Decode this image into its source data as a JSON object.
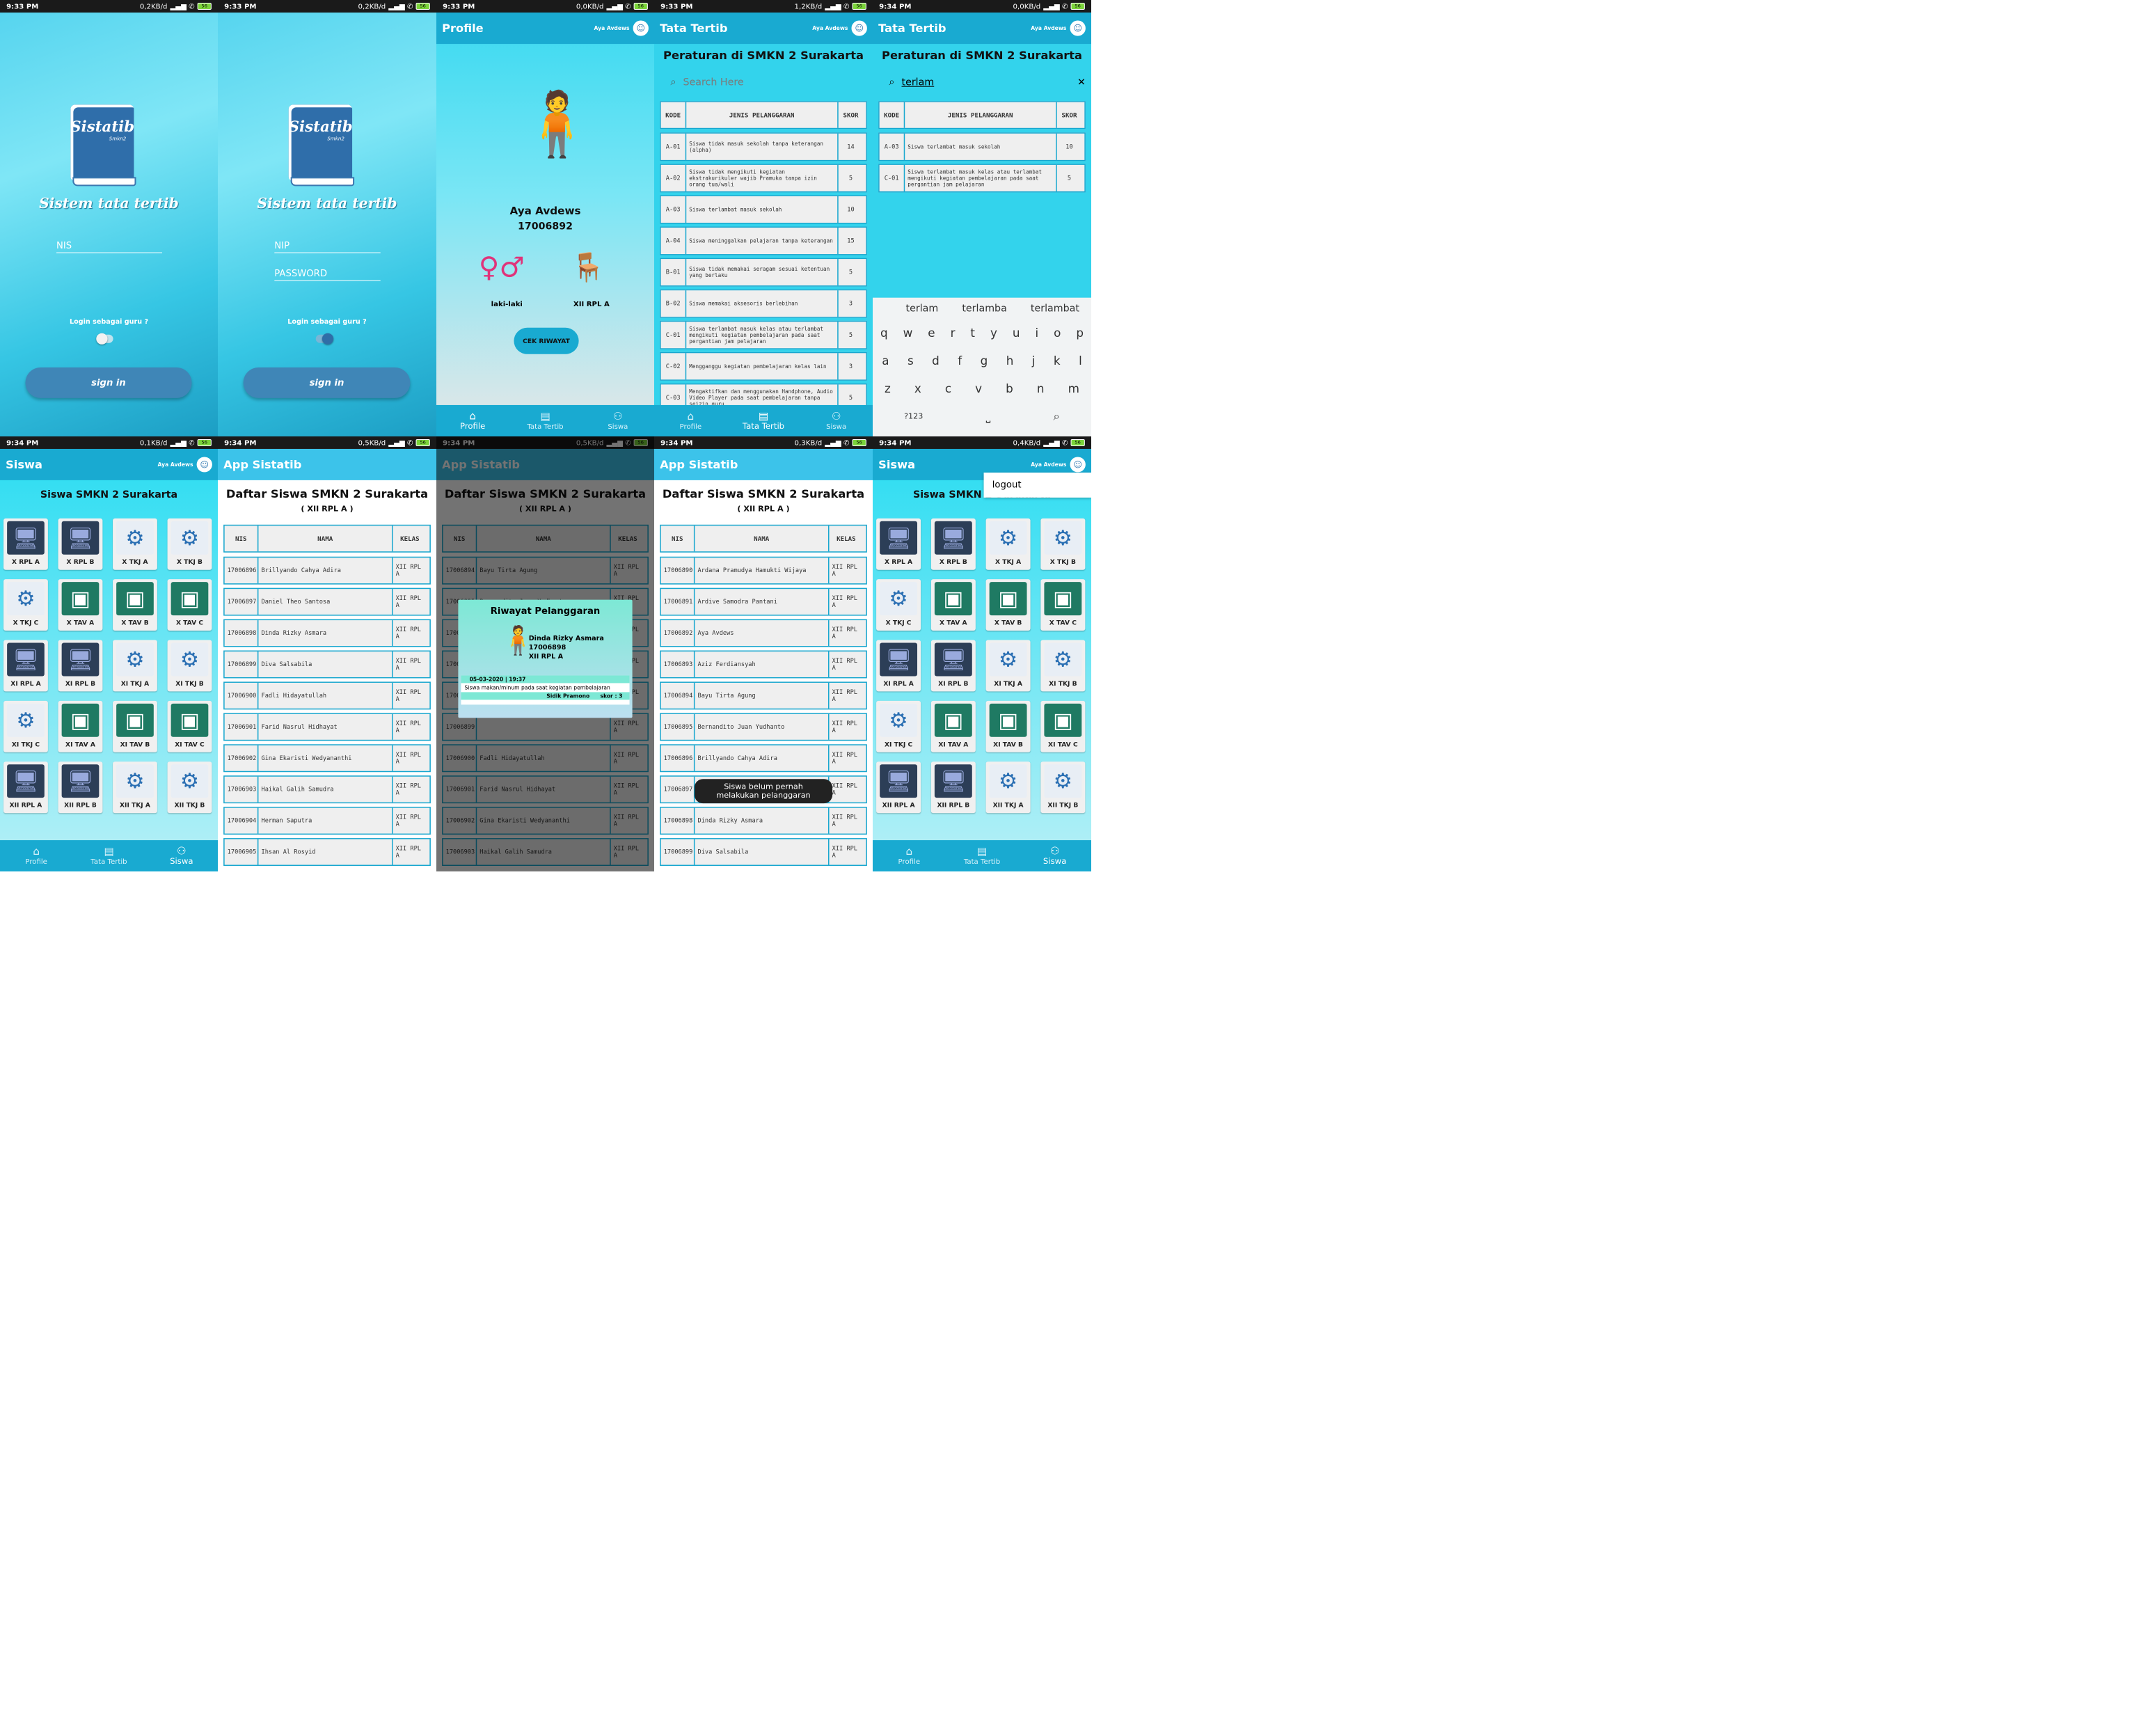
{
  "status": {
    "s1": {
      "time": "9:33 PM",
      "speed": "0,2KB/d",
      "bat": "56"
    },
    "s2": {
      "time": "9:33 PM",
      "speed": "0,2KB/d",
      "bat": "56"
    },
    "s3": {
      "time": "9:33 PM",
      "speed": "0,0KB/d",
      "bat": "56"
    },
    "s4": {
      "time": "9:33 PM",
      "speed": "1,2KB/d",
      "bat": "56"
    },
    "s5": {
      "time": "9:34 PM",
      "speed": "0,0KB/d",
      "bat": "56"
    },
    "s6": {
      "time": "9:34 PM",
      "speed": "0,1KB/d",
      "bat": "56"
    },
    "s7": {
      "time": "9:34 PM",
      "speed": "0,5KB/d",
      "bat": "56"
    },
    "s8": {
      "time": "9:34 PM",
      "speed": "0,5KB/d",
      "bat": "56"
    },
    "s9": {
      "time": "9:34 PM",
      "speed": "0,3KB/d",
      "bat": "56"
    },
    "s10": {
      "time": "9:34 PM",
      "speed": "0,4KB/d",
      "bat": "56"
    }
  },
  "login": {
    "logo_title": "Sistatib",
    "logo_sub": "Smkn2",
    "app_name": "Sistem tata tertib",
    "nis": "NIS",
    "nip": "NIP",
    "password": "PASSWORD",
    "guru_question": "Login sebagai guru ?",
    "signin": "sign in"
  },
  "user": {
    "name": "Aya Avdews",
    "nis": "17006892",
    "gender": "laki-laki",
    "kelas": "XII RPL A"
  },
  "titles": {
    "profile": "Profile",
    "tatatertib": "Tata Tertib",
    "siswa": "Siswa",
    "app": "App Sistatib"
  },
  "profile": {
    "cek": "CEK RIWAYAT"
  },
  "nav": {
    "profile": "Profile",
    "tatatertib": "Tata Tertib",
    "siswa": "Siswa"
  },
  "rules": {
    "heading": "Peraturan di SMKN 2 Surakarta",
    "search_placeholder": "Search Here",
    "search_value": "terlam",
    "col_kode": "KODE",
    "col_jenis": "JENIS PELANGGARAN",
    "col_skor": "SKOR",
    "rows": [
      {
        "kode": "A-01",
        "jenis": "Siswa tidak masuk sekolah tanpa keterangan (alpha)",
        "skor": "14"
      },
      {
        "kode": "A-02",
        "jenis": "Siswa tidak mengikuti kegiatan ekstrakurikuler wajib Pramuka tanpa izin orang tua/wali",
        "skor": "5"
      },
      {
        "kode": "A-03",
        "jenis": "Siswa terlambat masuk sekolah",
        "skor": "10"
      },
      {
        "kode": "A-04",
        "jenis": "Siswa meninggalkan pelajaran tanpa keterangan",
        "skor": "15"
      },
      {
        "kode": "B-01",
        "jenis": "Siswa tidak memakai seragam sesuai ketentuan yang berlaku",
        "skor": "5"
      },
      {
        "kode": "B-02",
        "jenis": "Siswa memakai aksesoris berlebihan",
        "skor": "3"
      },
      {
        "kode": "C-01",
        "jenis": "Siswa terlambat masuk kelas atau terlambat mengikuti kegiatan pembelajaran pada saat pergantian jam pelajaran",
        "skor": "5"
      },
      {
        "kode": "C-02",
        "jenis": "Mengganggu kegiatan pembelajaran kelas lain",
        "skor": "3"
      },
      {
        "kode": "C-03",
        "jenis": "Mengaktifkan dan menggunakan Handphone, Audio Video Player pada saat pembelajaran tanpa seizin guru",
        "skor": "5"
      }
    ],
    "filtered": [
      {
        "kode": "A-03",
        "jenis": "Siswa terlambat masuk sekolah",
        "skor": "10"
      },
      {
        "kode": "C-01",
        "jenis": "Siswa terlambat masuk kelas atau terlambat mengikuti kegiatan pembelajaran pada saat pergantian jam pelajaran",
        "skor": "5"
      }
    ]
  },
  "keyboard": {
    "sugg": [
      "terlam",
      "terlamba",
      "terlambat"
    ],
    "row1": [
      "q",
      "w",
      "e",
      "r",
      "t",
      "y",
      "u",
      "i",
      "o",
      "p"
    ],
    "row2": [
      "a",
      "s",
      "d",
      "f",
      "g",
      "h",
      "j",
      "k",
      "l"
    ],
    "row3": [
      "z",
      "x",
      "c",
      "v",
      "b",
      "n",
      "m"
    ],
    "sym": "?123"
  },
  "siswa_page": {
    "heading": "Siswa SMKN 2 Surakarta",
    "classes": [
      "X RPL A",
      "X RPL B",
      "X TKJ A",
      "X TKJ B",
      "X TKJ C",
      "X TAV A",
      "X TAV B",
      "X TAV C",
      "XI RPL A",
      "XI RPL B",
      "XI TKJ A",
      "XI TKJ B",
      "XI TKJ C",
      "XI TAV A",
      "XI TAV B",
      "XI TAV C",
      "XII RPL A",
      "XII RPL B",
      "XII TKJ A",
      "XII TKJ B"
    ],
    "logout": "logout"
  },
  "daftar": {
    "heading": "Daftar Siswa SMKN 2 Surakarta",
    "kelas": "( XII RPL A )",
    "col_nis": "NIS",
    "col_nama": "NAMA",
    "col_kelas": "KELAS",
    "list_a": [
      [
        "17006896",
        "Brillyando Cahya Adira"
      ],
      [
        "17006897",
        "Daniel Theo Santosa"
      ],
      [
        "17006898",
        "Dinda Rizky Asmara"
      ],
      [
        "17006899",
        "Diva Salsabila"
      ],
      [
        "17006900",
        "Fadli Hidayatullah"
      ],
      [
        "17006901",
        "Farid Nasrul Hidhayat"
      ],
      [
        "17006902",
        "Gina Ekaristi Wedyananthi"
      ],
      [
        "17006903",
        "Haikal Galih Samudra"
      ],
      [
        "17006904",
        "Herman Saputra"
      ],
      [
        "17006905",
        "Ihsan Al Rosyid"
      ]
    ],
    "list_b": [
      [
        "17006894",
        "Bayu Tirta Agung"
      ],
      [
        "17006895",
        "Bernandito Juan Yudhanto"
      ],
      [
        "17006896",
        ""
      ],
      [
        "17006897",
        ""
      ],
      [
        "17006898",
        ""
      ],
      [
        "17006899",
        ""
      ],
      [
        "17006900",
        "Fadli Hidayatullah"
      ],
      [
        "17006901",
        "Farid Nasrul Hidhayat"
      ],
      [
        "17006902",
        "Gina Ekaristi Wedyananthi"
      ],
      [
        "17006903",
        "Haikal Galih Samudra"
      ]
    ],
    "list_c": [
      [
        "17006890",
        "Ardana Pramudya Hamukti Wijaya"
      ],
      [
        "17006891",
        "Ardive Samodra Pantani"
      ],
      [
        "17006892",
        "Aya Avdews"
      ],
      [
        "17006893",
        "Aziz Ferdiansyah"
      ],
      [
        "17006894",
        "Bayu Tirta Agung"
      ],
      [
        "17006895",
        "Bernandito Juan Yudhanto"
      ],
      [
        "17006896",
        "Brillyando Cahya Adira"
      ],
      [
        "17006897",
        ""
      ],
      [
        "17006898",
        "Dinda Rizky Asmara"
      ],
      [
        "17006899",
        "Diva Salsabila"
      ]
    ]
  },
  "riwayat": {
    "title": "Riwayat Pelanggaran",
    "name": "Dinda Rizky Asmara",
    "nis": "17006898",
    "kelas": "XII RPL A",
    "date": "05-03-2020 | 19:37",
    "desc": "Siswa makan/minum pada saat kegiatan pembelajaran",
    "guru": "Sidik Pramono",
    "skor": "skor : 3"
  },
  "toast": "Siswa belum pernah melakukan pelanggaran"
}
